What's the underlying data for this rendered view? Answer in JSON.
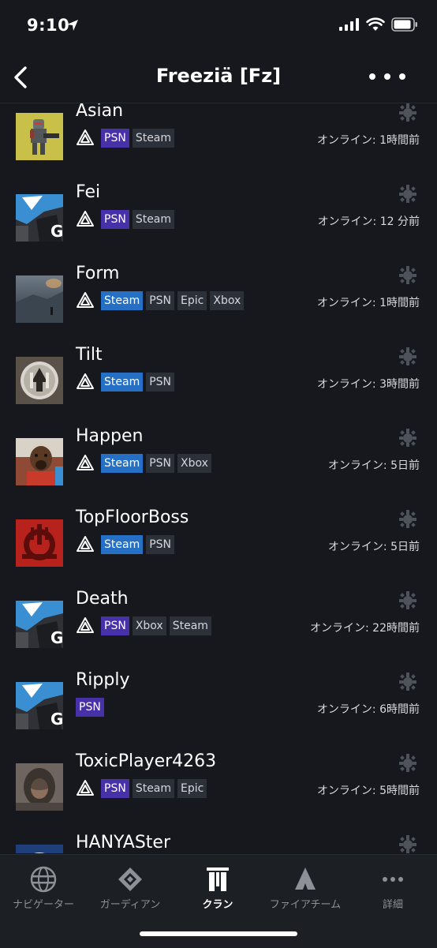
{
  "status": {
    "time": "9:10"
  },
  "header": {
    "title": "Freeziä [Fz]"
  },
  "members": [
    {
      "name": "Asian",
      "avatar": "avatar-asian",
      "platforms": [
        "PSN",
        "Steam"
      ],
      "online": "オンライン: 1時間前",
      "clan_icon": true
    },
    {
      "name": "Fei",
      "avatar": "avatar-fei",
      "platforms": [
        "PSN",
        "Steam"
      ],
      "online": "オンライン: 12 分前",
      "clan_icon": true
    },
    {
      "name": "Form",
      "avatar": "avatar-form",
      "platforms": [
        "Steam",
        "PSN",
        "Epic",
        "Xbox"
      ],
      "online": "オンライン: 1時間前",
      "clan_icon": true
    },
    {
      "name": "Tilt",
      "avatar": "avatar-tilt",
      "platforms": [
        "Steam",
        "PSN"
      ],
      "online": "オンライン: 3時間前",
      "clan_icon": true
    },
    {
      "name": "Happen",
      "avatar": "avatar-happen",
      "platforms": [
        "Steam",
        "PSN",
        "Xbox"
      ],
      "online": "オンライン: 5日前",
      "clan_icon": true
    },
    {
      "name": "TopFloorBoss",
      "avatar": "avatar-topfloorboss",
      "platforms": [
        "Steam",
        "PSN"
      ],
      "online": "オンライン: 5日前",
      "clan_icon": true
    },
    {
      "name": "Death",
      "avatar": "avatar-death",
      "platforms": [
        "PSN",
        "Xbox",
        "Steam"
      ],
      "online": "オンライン: 22時間前",
      "clan_icon": true
    },
    {
      "name": "Ripply",
      "avatar": "avatar-ripply",
      "platforms": [
        "PSN"
      ],
      "online": "オンライン: 6時間前",
      "clan_icon": false
    },
    {
      "name": "ToxicPlayer4263",
      "avatar": "avatar-toxicplayer",
      "platforms": [
        "PSN",
        "Steam",
        "Epic"
      ],
      "online": "オンライン: 5時間前",
      "clan_icon": true
    },
    {
      "name": "HANYASter",
      "avatar": "avatar-hanyaster",
      "platforms": [],
      "online": "",
      "clan_icon": false
    }
  ],
  "tabs": [
    {
      "label": "ナビゲーター",
      "icon": "globe-icon",
      "active": false
    },
    {
      "label": "ガーディアン",
      "icon": "guardian-icon",
      "active": false
    },
    {
      "label": "クラン",
      "icon": "clan-banner-icon",
      "active": true
    },
    {
      "label": "ファイアチーム",
      "icon": "fireteam-icon",
      "active": false
    },
    {
      "label": "詳細",
      "icon": "more-dots-icon",
      "active": false
    }
  ],
  "colors": {
    "background": "#16181d",
    "psn_badge": "#4731a8",
    "steam_badge": "#2570c4",
    "other_badge": "#2c3039",
    "tab_bar": "#1c1f24"
  }
}
